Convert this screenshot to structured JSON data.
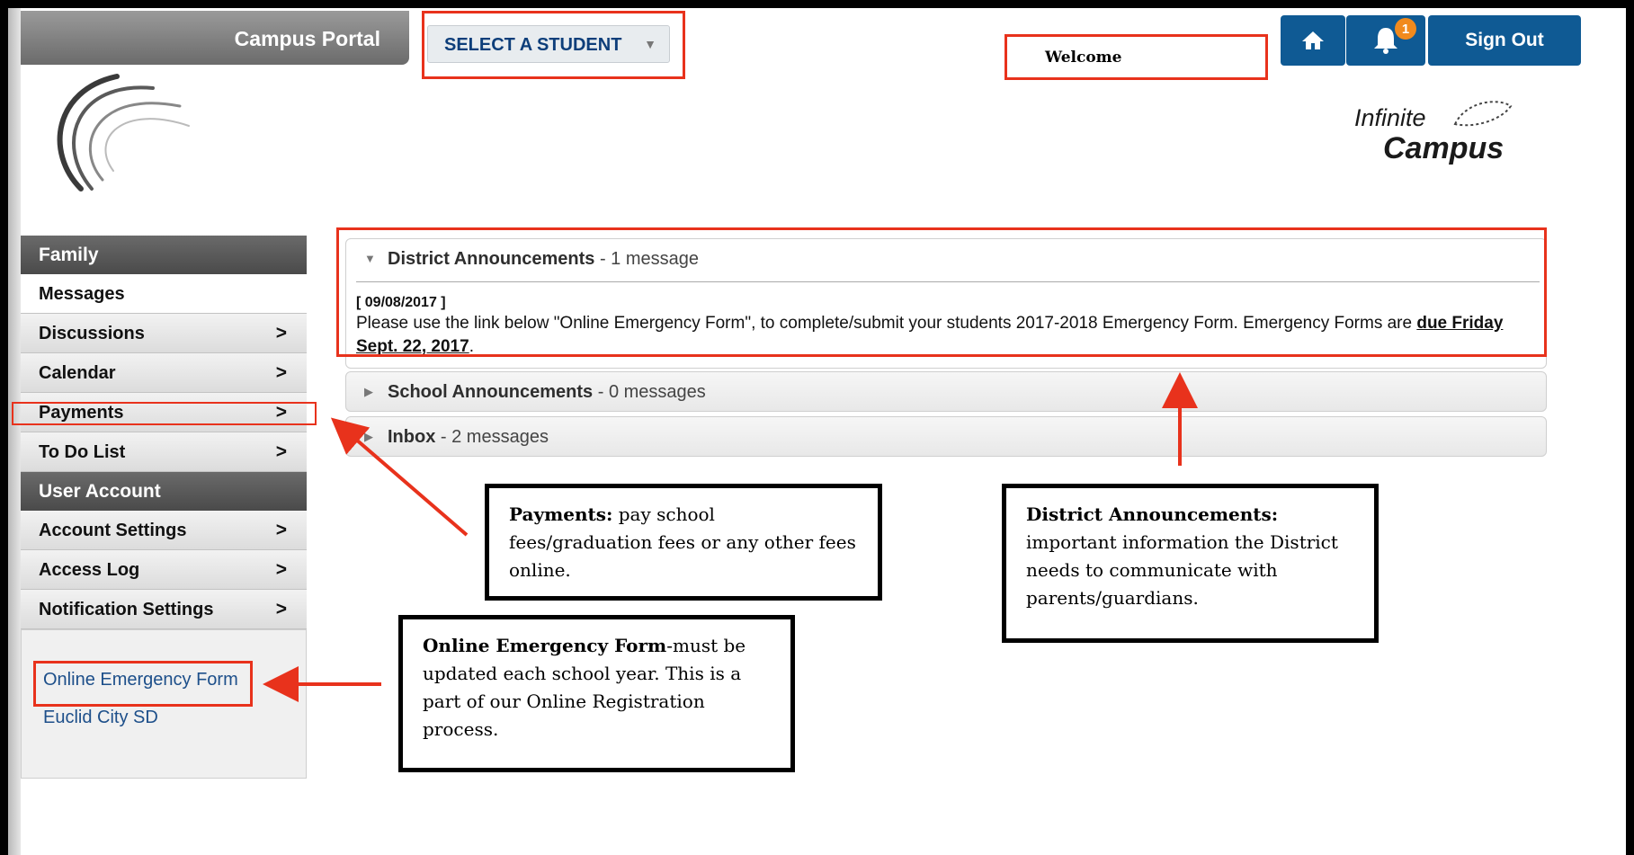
{
  "header": {
    "portal_title": "Campus Portal",
    "student_select": "SELECT A STUDENT",
    "welcome": "Welcome",
    "notification_count": "1",
    "sign_out": "Sign Out",
    "brand_line1": "Infinite",
    "brand_line2": "Campus"
  },
  "sidebar": {
    "family_heading": "Family",
    "items": [
      {
        "label": "Messages"
      },
      {
        "label": "Discussions"
      },
      {
        "label": "Calendar"
      },
      {
        "label": "Payments"
      },
      {
        "label": "To Do List"
      }
    ],
    "account_heading": "User Account",
    "account_items": [
      {
        "label": "Account Settings"
      },
      {
        "label": "Access Log"
      },
      {
        "label": "Notification Settings"
      }
    ],
    "chevron": ">",
    "links": [
      "Online Emergency Form",
      "Euclid City SD"
    ]
  },
  "announcements": {
    "district": {
      "title": "District Announcements",
      "count": "- 1 message"
    },
    "date": "[ 09/08/2017 ]",
    "message_text": "Please use the link below \"Online Emergency Form\", to complete/submit your students 2017-2018 Emergency Form.  Emergency Forms are ",
    "message_due": "due Friday Sept. 22, 2017",
    "message_end": ".",
    "school": {
      "title": "School Announcements",
      "count": "- 0 messages"
    },
    "inbox": {
      "title": "Inbox",
      "count": "- 2 messages"
    }
  },
  "callouts": {
    "payments_title": "Payments:",
    "payments_text": " pay school fees/graduation fees or any other fees online.",
    "district_title": "District Announcements:",
    "district_text": "important information the District needs to communicate with parents/guardians.",
    "form_title": "Online Emergency Form",
    "form_text": "-must be updated each school year. This is a part of our Online Registration process."
  },
  "colors": {
    "accent_blue": "#0f5a94",
    "highlight_red": "#e8321c",
    "badge_orange": "#f18a1d",
    "link_blue": "#1d4f8a"
  }
}
